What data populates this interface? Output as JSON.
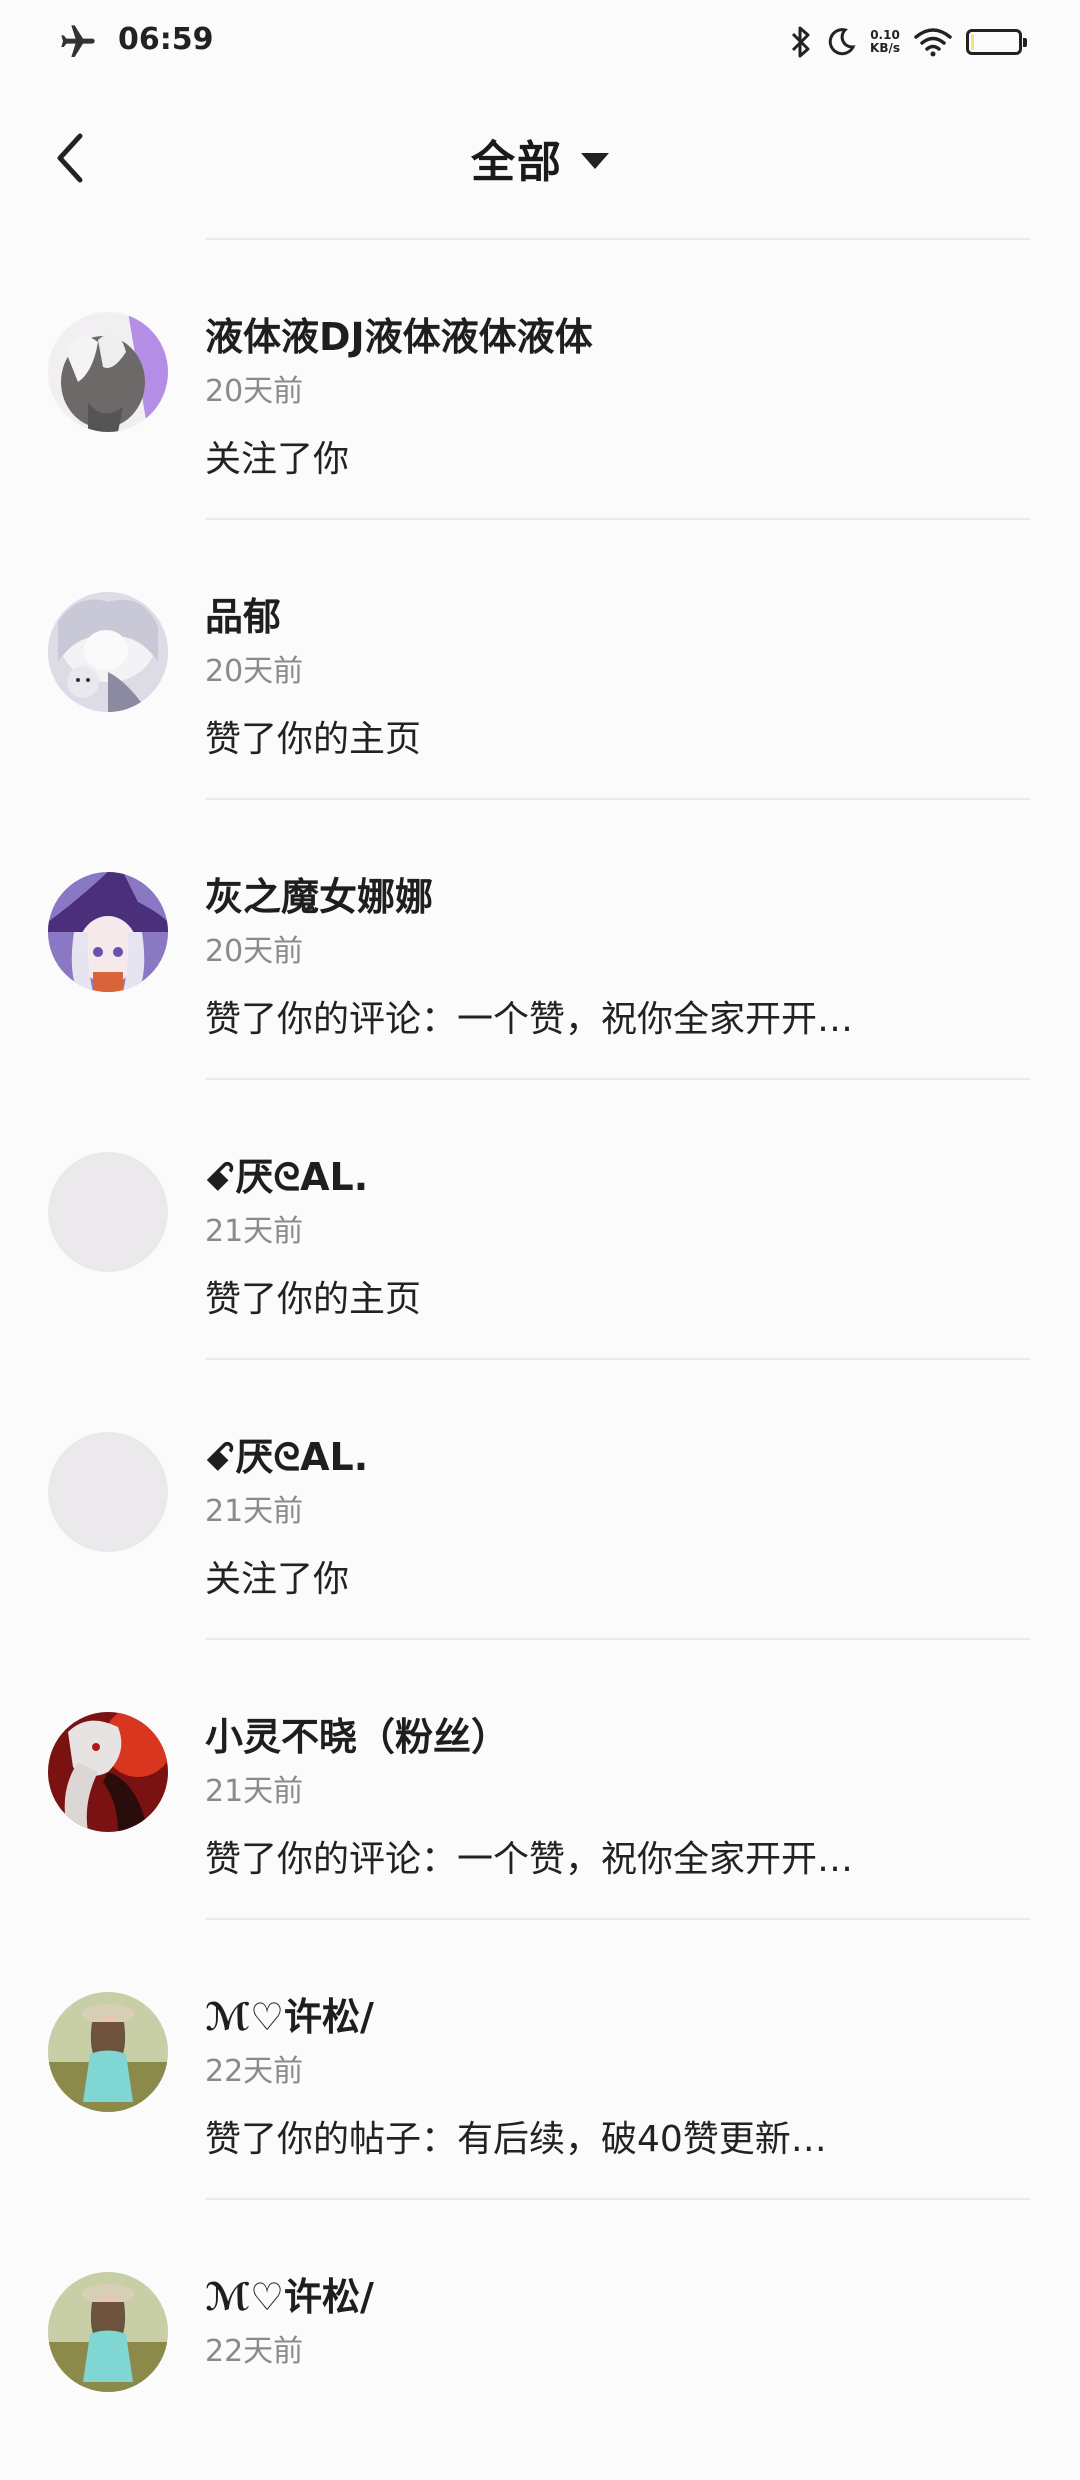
{
  "status_bar": {
    "time": "06:59",
    "net_speed_value": "0.10",
    "net_speed_unit": "KB/s",
    "icons": [
      "airplane-icon",
      "bluetooth-icon",
      "moon-icon",
      "wifi-icon",
      "battery-icon"
    ],
    "battery_level": 0.05
  },
  "header": {
    "title": "全部",
    "back_icon": "chevron-left-icon",
    "dropdown_icon": "caret-down-icon"
  },
  "notifications": [
    {
      "name": "液体液DJ液体液体液体",
      "time": "20天前",
      "action": "关注了你",
      "avatar": "gray-creature"
    },
    {
      "name": "品郁",
      "time": "20天前",
      "action": "赞了你的主页",
      "avatar": "anime-white-hair"
    },
    {
      "name": "灰之魔女娜娜",
      "time": "20天前",
      "action": "赞了你的评论：一个赞，祝你全家开开…",
      "avatar": "witch-hat"
    },
    {
      "name": "ꗃ厌ᘓAL.",
      "time": "21天前",
      "action": "赞了你的主页",
      "avatar": "blank"
    },
    {
      "name": "ꗃ厌ᘓAL.",
      "time": "21天前",
      "action": "关注了你",
      "avatar": "blank"
    },
    {
      "name": "小灵不晓（粉丝）",
      "time": "21天前",
      "action": "赞了你的评论：一个赞，祝你全家开开…",
      "avatar": "red-anime"
    },
    {
      "name": "ℳ♡许松/",
      "time": "22天前",
      "action": "赞了你的帖子：有后续，破40赞更新…",
      "avatar": "girl-photo"
    },
    {
      "name": "ℳ♡许松/",
      "time": "22天前",
      "action": "",
      "avatar": "girl-photo"
    }
  ],
  "colors": {
    "background": "#fcfbfc",
    "divider": "#ecebec",
    "time_text": "#8a8a8a"
  }
}
